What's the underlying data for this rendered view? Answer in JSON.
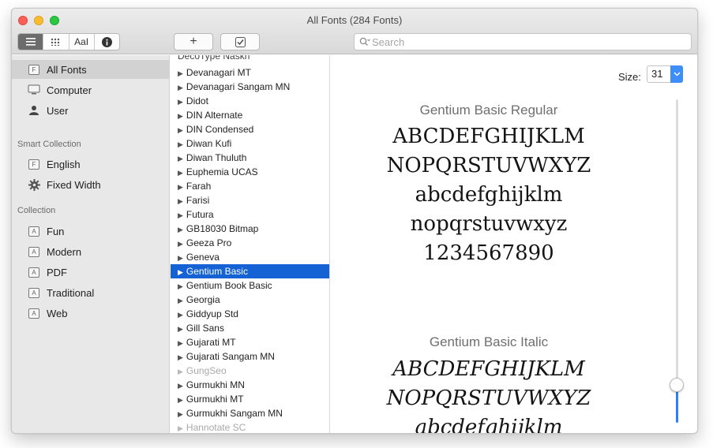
{
  "window": {
    "title": "All Fonts (284 Fonts)"
  },
  "toolbar": {
    "view_modes": [
      {
        "name": "list-view",
        "icon": "list-icon"
      },
      {
        "name": "grid-view",
        "icon": "grid-icon"
      },
      {
        "name": "sample-view",
        "label": "AaI"
      },
      {
        "name": "info-view",
        "icon": "info-icon"
      }
    ],
    "add_label": "+",
    "check_icon": "checkbox-icon",
    "search_placeholder": "Search"
  },
  "sidebar": {
    "library_items": [
      {
        "label": "All Fonts",
        "icon": "font-box-icon",
        "selected": true
      },
      {
        "label": "Computer",
        "icon": "computer-icon"
      },
      {
        "label": "User",
        "icon": "user-icon"
      }
    ],
    "smart_header": "Smart Collection",
    "smart_items": [
      {
        "label": "English",
        "icon": "font-box-icon"
      },
      {
        "label": "Fixed Width",
        "icon": "gear-icon"
      }
    ],
    "collection_header": "Collection",
    "collection_items": [
      {
        "label": "Fun",
        "icon": "collection-icon"
      },
      {
        "label": "Modern",
        "icon": "collection-icon"
      },
      {
        "label": "PDF",
        "icon": "collection-icon"
      },
      {
        "label": "Traditional",
        "icon": "collection-icon"
      },
      {
        "label": "Web",
        "icon": "collection-icon"
      }
    ],
    "add_label": "+"
  },
  "font_list": {
    "cut_top": "DecoType Naskh",
    "items": [
      {
        "label": "Devanagari MT"
      },
      {
        "label": "Devanagari Sangam MN"
      },
      {
        "label": "Didot"
      },
      {
        "label": "DIN Alternate"
      },
      {
        "label": "DIN Condensed"
      },
      {
        "label": "Diwan Kufi"
      },
      {
        "label": "Diwan Thuluth"
      },
      {
        "label": "Euphemia UCAS"
      },
      {
        "label": "Farah"
      },
      {
        "label": "Farisi"
      },
      {
        "label": "Futura"
      },
      {
        "label": "GB18030 Bitmap"
      },
      {
        "label": "Geeza Pro"
      },
      {
        "label": "Geneva"
      },
      {
        "label": "Gentium Basic",
        "selected": true
      },
      {
        "label": "Gentium Book Basic"
      },
      {
        "label": "Georgia"
      },
      {
        "label": "Giddyup Std"
      },
      {
        "label": "Gill Sans"
      },
      {
        "label": "Gujarati MT"
      },
      {
        "label": "Gujarati Sangam MN"
      },
      {
        "label": "GungSeo",
        "dim": true
      },
      {
        "label": "Gurmukhi MN"
      },
      {
        "label": "Gurmukhi MT"
      },
      {
        "label": "Gurmukhi Sangam MN"
      },
      {
        "label": "Hannotate SC",
        "dim": true
      }
    ]
  },
  "preview": {
    "size_label": "Size:",
    "size_value": "31",
    "size_level": 0.12,
    "sections": [
      {
        "name": "Gentium Basic Regular",
        "style": "regular",
        "lines": [
          "ABCDEFGHIJKLM",
          "NOPQRSTUVWXYZ",
          "abcdefghijklm",
          "nopqrstuvwxyz",
          "1234567890"
        ]
      },
      {
        "name": "Gentium Basic Italic",
        "style": "italic",
        "lines": [
          "ABCDEFGHIJKLM",
          "NOPQRSTUVWXYZ",
          "abcdefghijklm"
        ]
      }
    ]
  },
  "colors": {
    "selection": "#1462d4",
    "accent": "#3d8ef8"
  }
}
